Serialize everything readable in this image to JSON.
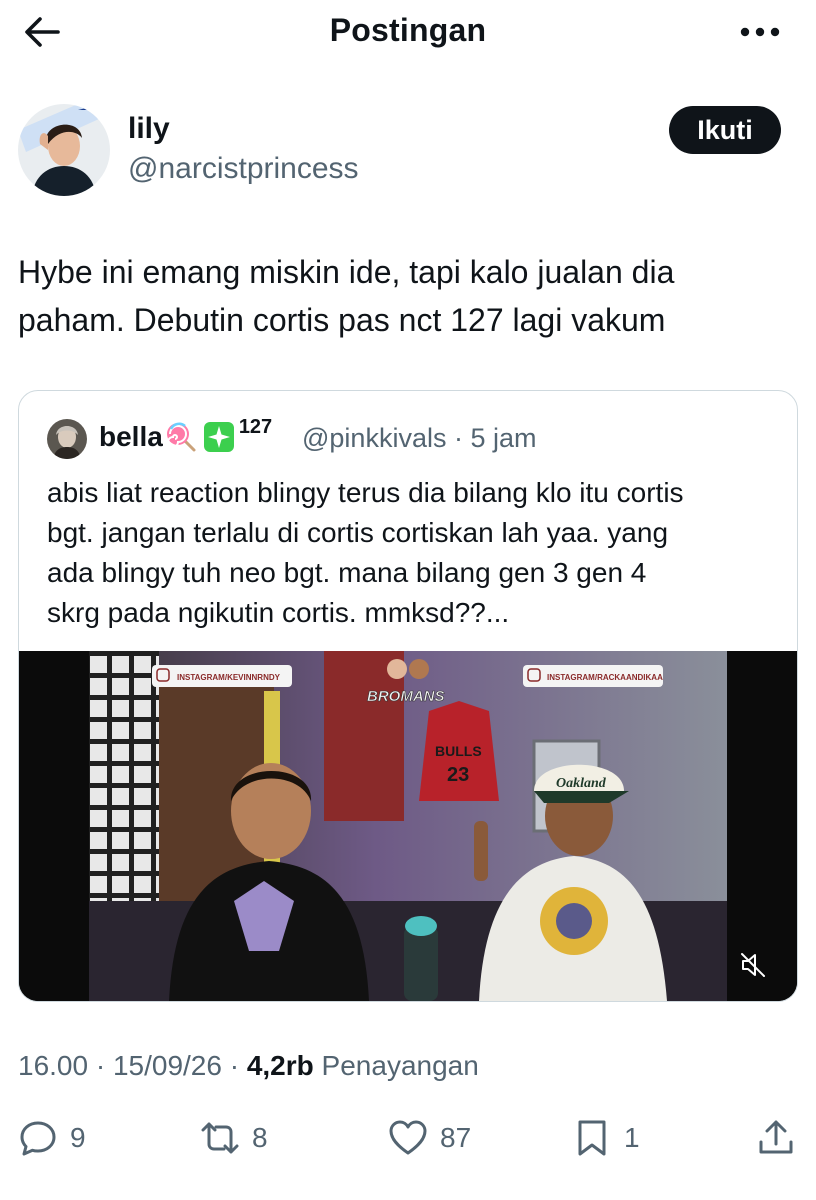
{
  "header": {
    "title": "Postingan"
  },
  "author": {
    "name": "lily",
    "handle": "@narcistprincess",
    "follow_label": "Ikuti"
  },
  "post": {
    "line1": "Hybe ini emang miskin ide, tapi kalo jualan dia",
    "line2": "paham. Debutin cortis pas nct 127 lagi vakum"
  },
  "quote": {
    "name": "bella",
    "badge_sup": "127",
    "handle_time": "@pinkkivals · 5 jam",
    "text_lines": [
      "abis liat reaction blingy terus dia bilang klo itu cortis",
      "bgt. jangan terlalu di cortis cortiskan lah yaa. yang",
      "ada blingy tuh neo bgt. mana bilang gen 3 gen 4",
      "skrg pada ngikutin cortis. mmksd??..."
    ],
    "video": {
      "left_tag": "INSTAGRAM/KEVINNRNDY",
      "right_tag": "INSTAGRAM/RACKAANDIKAA",
      "channel": "BROMANS",
      "hat_text": "Oakland",
      "shirt_text": "BULLS",
      "shirt_number": "23"
    }
  },
  "meta": {
    "time": "16.00 · 15/09/26 · ",
    "views": "4,2rb",
    "views_label": " Penayangan"
  },
  "actions": {
    "replies": "9",
    "reposts": "8",
    "likes": "87",
    "bookmarks": "1"
  },
  "colors": {
    "text": "#0f1419",
    "secondary": "#536471",
    "border": "#cfd9de"
  }
}
